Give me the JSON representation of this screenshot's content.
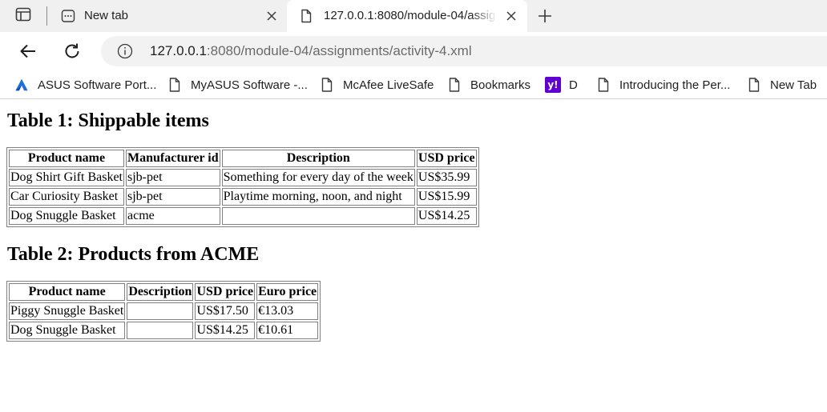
{
  "browser": {
    "tabs": [
      {
        "title": "New tab",
        "icon": "new-tab-page-icon",
        "active": false
      },
      {
        "title": "127.0.0.1:8080/module-04/assignments/activity-4.xml",
        "icon": "document-icon",
        "active": true
      }
    ],
    "address": {
      "host": "127.0.0.1",
      "rest": ":8080/module-04/assignments/activity-4.xml"
    },
    "bookmarks": [
      {
        "label": "ASUS Software Port...",
        "icon": "asus-icon"
      },
      {
        "label": "MyASUS Software -...",
        "icon": "document-icon"
      },
      {
        "label": "McAfee LiveSafe",
        "icon": "document-icon"
      },
      {
        "label": "Bookmarks",
        "icon": "document-icon"
      },
      {
        "label": "D",
        "icon": "yahoo-icon",
        "icon_text": "y!"
      },
      {
        "label": "Introducing the Per...",
        "icon": "document-icon"
      },
      {
        "label": "New Tab",
        "icon": "document-icon"
      }
    ]
  },
  "page": {
    "table1": {
      "heading": "Table 1: Shippable items",
      "columns": [
        "Product name",
        "Manufacturer id",
        "Description",
        "USD price"
      ],
      "rows": [
        [
          "Dog Shirt Gift Basket",
          "sjb-pet",
          "Something for every day of the week",
          "US$35.99"
        ],
        [
          "Car Curiosity Basket",
          "sjb-pet",
          "Playtime morning, noon, and night",
          "US$15.99"
        ],
        [
          "Dog Snuggle Basket",
          "acme",
          "",
          "US$14.25"
        ]
      ]
    },
    "table2": {
      "heading": "Table 2: Products from ACME",
      "columns": [
        "Product name",
        "Description",
        "USD price",
        "Euro price"
      ],
      "rows": [
        [
          "Piggy Snuggle Basket",
          "",
          "US$17.50",
          "€13.03"
        ],
        [
          "Dog Snuggle Basket",
          "",
          "US$14.25",
          "€10.61"
        ]
      ]
    }
  }
}
